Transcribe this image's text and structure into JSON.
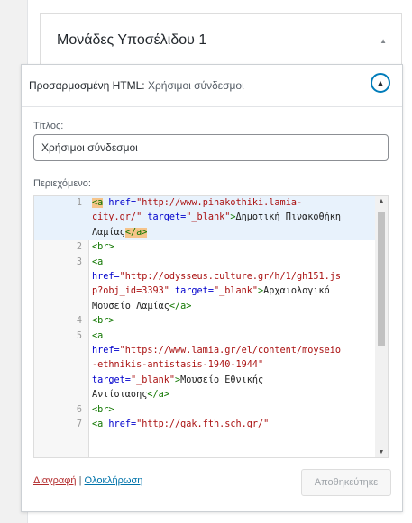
{
  "widget_area": {
    "title": "Μονάδες Υποσέλιδου 1"
  },
  "widget": {
    "type_label": "Προσαρμοσμένη HTML:",
    "title_label": "Χρήσιμοι σύνδεσμοι",
    "title_field_label": "Τίτλος:",
    "title_value": "Χρήσιμοι σύνδεσμοι",
    "content_label": "Περιεχόμενο:",
    "delete_link": "Διαγραφή",
    "separator": "|",
    "done_link": "Ολοκλήρωση",
    "save_button": "Αποθηκεύτηκε"
  },
  "code": {
    "active_line": 1,
    "lines": [
      {
        "num": "1",
        "tokens": [
          {
            "t": "<a",
            "c": "tag",
            "m": true
          },
          {
            "t": " ",
            "c": "txt"
          },
          {
            "t": "href=",
            "c": "attr"
          },
          {
            "t": "\"http://www.pinakothiki.lamia-",
            "c": "str"
          }
        ]
      },
      {
        "num": "",
        "tokens": [
          {
            "t": "city.gr/\"",
            "c": "str"
          },
          {
            "t": " ",
            "c": "txt"
          },
          {
            "t": "target=",
            "c": "attr"
          },
          {
            "t": "\"_blank\"",
            "c": "str"
          },
          {
            "t": ">",
            "c": "tag"
          },
          {
            "t": "Δημοτική Πινακοθήκη",
            "c": "txt"
          }
        ]
      },
      {
        "num": "",
        "tokens": [
          {
            "t": "Λαμίας",
            "c": "txt"
          },
          {
            "t": "</a>",
            "c": "tag",
            "m": true
          }
        ]
      },
      {
        "num": "2",
        "tokens": [
          {
            "t": "<br>",
            "c": "tag"
          }
        ]
      },
      {
        "num": "3",
        "tokens": [
          {
            "t": "<a",
            "c": "tag"
          }
        ]
      },
      {
        "num": "",
        "tokens": [
          {
            "t": "href=",
            "c": "attr"
          },
          {
            "t": "\"http://odysseus.culture.gr/h/1/gh151.js",
            "c": "str"
          }
        ]
      },
      {
        "num": "",
        "tokens": [
          {
            "t": "p?obj_id=3393\"",
            "c": "str"
          },
          {
            "t": " ",
            "c": "txt"
          },
          {
            "t": "target=",
            "c": "attr"
          },
          {
            "t": "\"_blank\"",
            "c": "str"
          },
          {
            "t": ">",
            "c": "tag"
          },
          {
            "t": "Αρχαιολογικό",
            "c": "txt"
          }
        ]
      },
      {
        "num": "",
        "tokens": [
          {
            "t": "Μουσείο Λαμίας",
            "c": "txt"
          },
          {
            "t": "</a>",
            "c": "tag"
          }
        ]
      },
      {
        "num": "4",
        "tokens": [
          {
            "t": "<br>",
            "c": "tag"
          }
        ]
      },
      {
        "num": "5",
        "tokens": [
          {
            "t": "<a",
            "c": "tag"
          }
        ]
      },
      {
        "num": "",
        "tokens": [
          {
            "t": "href=",
            "c": "attr"
          },
          {
            "t": "\"https://www.lamia.gr/el/content/moyseio",
            "c": "str"
          }
        ]
      },
      {
        "num": "",
        "tokens": [
          {
            "t": "-ethnikis-antistasis-1940-1944\"",
            "c": "str"
          }
        ]
      },
      {
        "num": "",
        "tokens": [
          {
            "t": "target=",
            "c": "attr"
          },
          {
            "t": "\"_blank\"",
            "c": "str"
          },
          {
            "t": ">",
            "c": "tag"
          },
          {
            "t": "Μουσείο Εθνικής",
            "c": "txt"
          }
        ]
      },
      {
        "num": "",
        "tokens": [
          {
            "t": "Αντίστασης",
            "c": "txt"
          },
          {
            "t": "</a>",
            "c": "tag"
          }
        ]
      },
      {
        "num": "6",
        "tokens": [
          {
            "t": "<br>",
            "c": "tag"
          }
        ]
      },
      {
        "num": "7",
        "tokens": [
          {
            "t": "<a",
            "c": "tag"
          },
          {
            "t": " ",
            "c": "txt"
          },
          {
            "t": "href=",
            "c": "attr"
          },
          {
            "t": "\"http://gak.fth.sch.gr/\"",
            "c": "str"
          }
        ]
      }
    ]
  }
}
